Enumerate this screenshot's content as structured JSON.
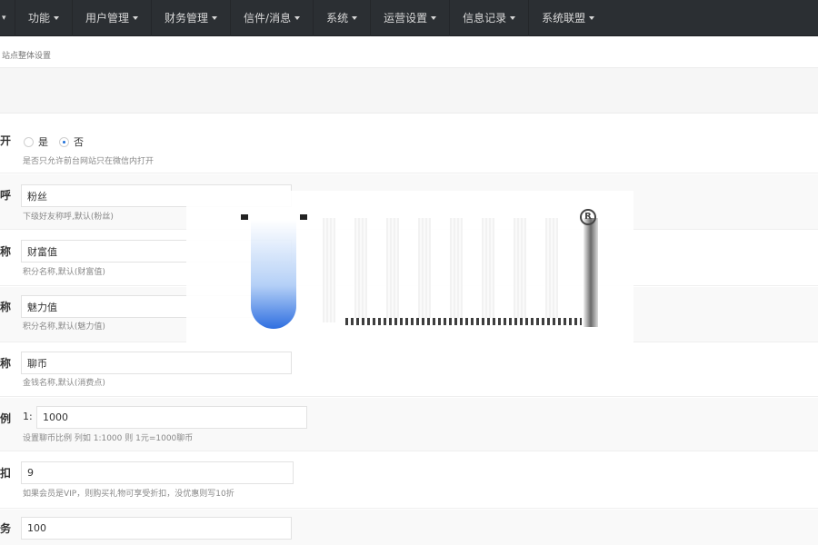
{
  "nav": {
    "items": [
      {
        "label": "功能"
      },
      {
        "label": "用户管理"
      },
      {
        "label": "财务管理"
      },
      {
        "label": "信件/消息"
      },
      {
        "label": "系统"
      },
      {
        "label": "运营设置"
      },
      {
        "label": "信息记录"
      },
      {
        "label": "系统联盟"
      }
    ]
  },
  "breadcrumb": "站点整体设置",
  "rows": {
    "open": {
      "label": "开",
      "options": [
        {
          "label": "是",
          "checked": false
        },
        {
          "label": "否",
          "checked": true
        }
      ],
      "hint": "是否只允许前台网站只在微信内打开"
    },
    "fans": {
      "label": "呼",
      "value": "粉丝",
      "hint": "下级好友称呼,默认(粉丝)"
    },
    "wealth": {
      "label": "称",
      "value": "财富值",
      "hint": "积分名称,默认(财富值)"
    },
    "charm": {
      "label": "称",
      "value": "魅力值",
      "hint": "积分名称,默认(魅力值)"
    },
    "coin": {
      "label": "称",
      "value": "聊币",
      "hint": "金钱名称,默认(消费点)"
    },
    "ratio": {
      "label": "例",
      "prefix": "1:",
      "value": "1000",
      "hint": "设置聊币比例 列如 1:1000 则 1元=1000聊币"
    },
    "discount": {
      "label": "扣",
      "value": "9",
      "hint": "如果会员是VIP，则购买礼物可享受折扣，没优惠则写10折"
    },
    "last": {
      "label": "务",
      "value": "100"
    }
  }
}
